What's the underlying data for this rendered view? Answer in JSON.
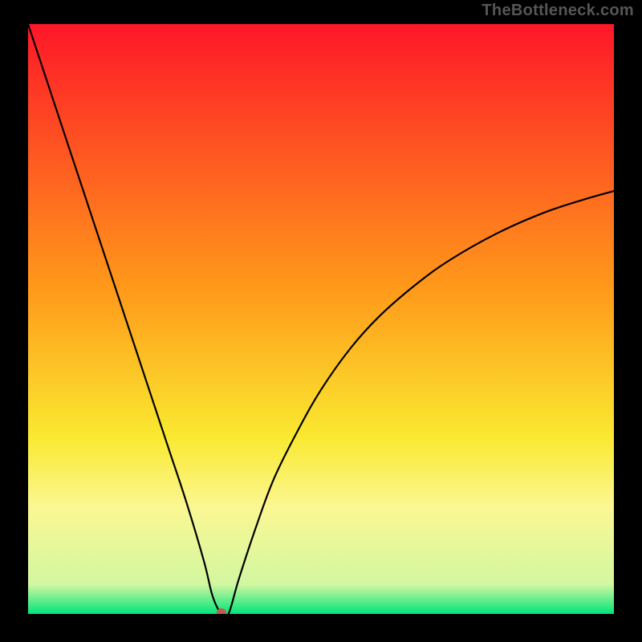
{
  "watermark": "TheBottleneck.com",
  "chart_data": {
    "type": "line",
    "title": "",
    "xlabel": "",
    "ylabel": "",
    "xlim": [
      0,
      100
    ],
    "ylim": [
      0,
      100
    ],
    "grid": false,
    "legend": "none",
    "background_gradient": {
      "type": "vertical",
      "stops": [
        {
          "pos": 0.0,
          "color": "#fe1728"
        },
        {
          "pos": 0.45,
          "color": "#ff9a1a"
        },
        {
          "pos": 0.7,
          "color": "#fae930"
        },
        {
          "pos": 0.82,
          "color": "#fbf793"
        },
        {
          "pos": 0.95,
          "color": "#d2f7a1"
        },
        {
          "pos": 1.0,
          "color": "#00e57a"
        }
      ]
    },
    "notch_marker": {
      "x": 33.0,
      "y": 0.0,
      "color": "#c45a4f"
    },
    "series": [
      {
        "name": "curve",
        "x": [
          0.0,
          3,
          6,
          9,
          12,
          15,
          18,
          21,
          24,
          27,
          30,
          31.5,
          33,
          34.2,
          36,
          39,
          42,
          46,
          50,
          55,
          60,
          66,
          72,
          80,
          88,
          95,
          100
        ],
        "y": [
          100,
          91,
          82,
          73,
          64,
          55,
          46,
          37,
          28,
          19,
          9,
          3,
          0,
          0,
          6,
          15,
          23,
          31,
          38,
          45,
          50.5,
          55.7,
          60,
          64.5,
          68,
          70.3,
          71.7
        ]
      }
    ]
  }
}
